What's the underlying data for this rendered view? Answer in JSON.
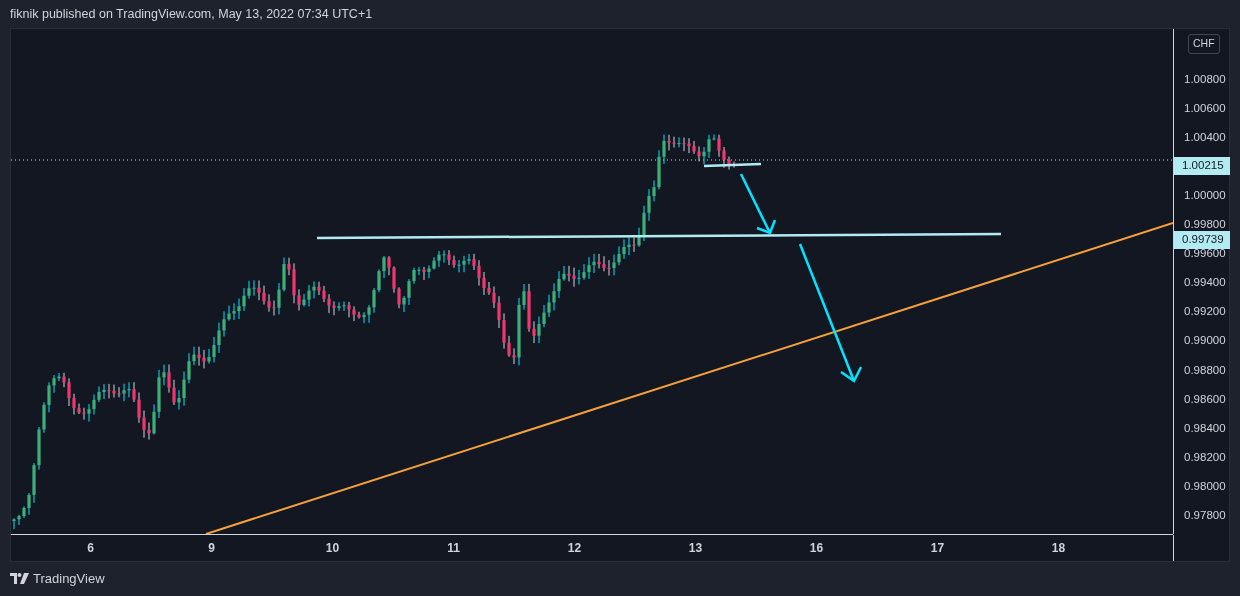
{
  "header": {
    "text": "fiknik published on TradingView.com, May 13, 2022 07:34 UTC+1"
  },
  "price_axis": {
    "currency_badge": "CHF",
    "ticks_upper": [
      "1.00800",
      "1.00600",
      "1.00400"
    ],
    "ticks_lower": [
      "1.00000",
      "0.99800",
      "0.99600",
      "0.99400",
      "0.99200",
      "0.99000",
      "0.98800",
      "0.98600",
      "0.98400",
      "0.98200",
      "0.98000",
      "0.97800"
    ],
    "markers": [
      {
        "label": "1.00215"
      },
      {
        "label": "0.99739"
      }
    ]
  },
  "time_axis": {
    "ticks": [
      "6",
      "9",
      "10",
      "11",
      "12",
      "13",
      "16",
      "17",
      "18"
    ]
  },
  "footer": {
    "logo_text": "TradingView"
  }
}
